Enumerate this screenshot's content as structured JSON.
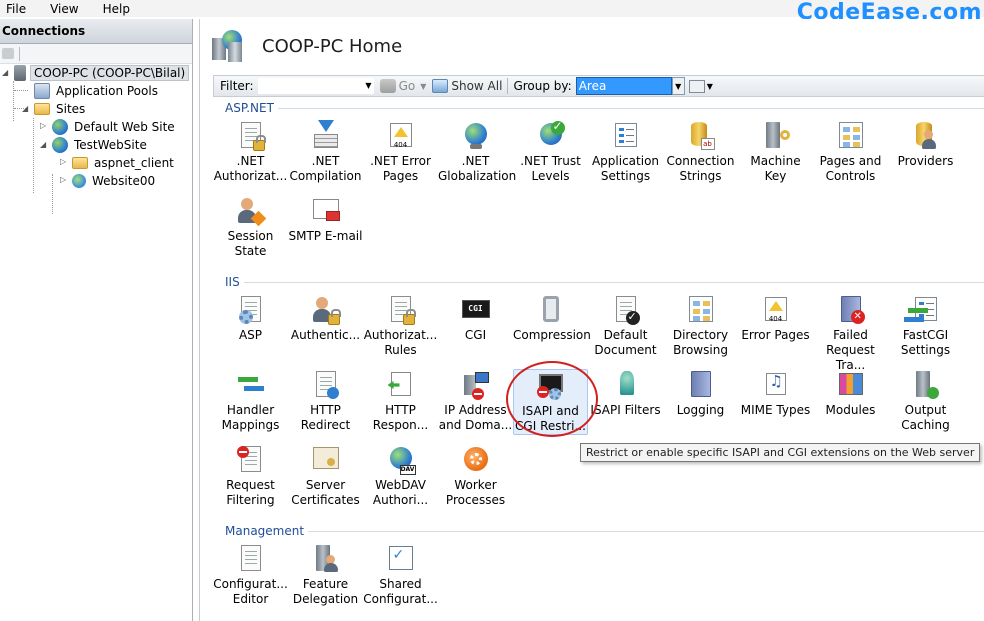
{
  "menu": [
    "File",
    "View",
    "Help"
  ],
  "watermark": "CodeEase.com",
  "connections": {
    "title": "Connections",
    "tree": {
      "server": "COOP-PC (COOP-PC\\Bilal)",
      "app_pools": "Application Pools",
      "sites": "Sites",
      "default_site": "Default Web Site",
      "test_site": "TestWebSite",
      "aspnet_client": "aspnet_client",
      "website00": "Website00"
    }
  },
  "main": {
    "title": "COOP-PC Home",
    "filter": {
      "label": "Filter:",
      "value": "",
      "go": "Go",
      "show_all": "Show All",
      "group_by_label": "Group by:",
      "group_by_value": "Area"
    },
    "sections": {
      "aspnet": {
        "title": "ASP.NET",
        "items": [
          {
            "label": ".NET\nAuthorizat...",
            "icon": "net-authorization-icon"
          },
          {
            "label": ".NET\nCompilation",
            "icon": "net-compilation-icon"
          },
          {
            "label": ".NET Error\nPages",
            "icon": "net-error-pages-icon"
          },
          {
            "label": ".NET\nGlobalization",
            "icon": "net-globalization-icon"
          },
          {
            "label": ".NET Trust\nLevels",
            "icon": "net-trust-levels-icon"
          },
          {
            "label": "Application\nSettings",
            "icon": "application-settings-icon"
          },
          {
            "label": "Connection\nStrings",
            "icon": "connection-strings-icon"
          },
          {
            "label": "Machine Key",
            "icon": "machine-key-icon"
          },
          {
            "label": "Pages and\nControls",
            "icon": "pages-and-controls-icon"
          },
          {
            "label": "Providers",
            "icon": "providers-icon"
          },
          {
            "label": "Session State",
            "icon": "session-state-icon"
          },
          {
            "label": "SMTP E-mail",
            "icon": "smtp-email-icon"
          }
        ]
      },
      "iis": {
        "title": "IIS",
        "items": [
          {
            "label": "ASP",
            "icon": "asp-icon"
          },
          {
            "label": "Authentic...",
            "icon": "authentication-icon"
          },
          {
            "label": "Authorizat...\nRules",
            "icon": "authorization-rules-icon"
          },
          {
            "label": "CGI",
            "icon": "cgi-icon"
          },
          {
            "label": "Compression",
            "icon": "compression-icon"
          },
          {
            "label": "Default\nDocument",
            "icon": "default-document-icon"
          },
          {
            "label": "Directory\nBrowsing",
            "icon": "directory-browsing-icon"
          },
          {
            "label": "Error Pages",
            "icon": "error-pages-icon"
          },
          {
            "label": "Failed\nRequest Tra...",
            "icon": "failed-request-tracing-icon"
          },
          {
            "label": "FastCGI\nSettings",
            "icon": "fastcgi-settings-icon"
          },
          {
            "label": "Handler\nMappings",
            "icon": "handler-mappings-icon"
          },
          {
            "label": "HTTP\nRedirect",
            "icon": "http-redirect-icon"
          },
          {
            "label": "HTTP\nRespon...",
            "icon": "http-response-headers-icon"
          },
          {
            "label": "IP Address\nand Doma...",
            "icon": "ip-address-domain-icon"
          },
          {
            "label": "ISAPI and\nCGI Restri...",
            "icon": "isapi-cgi-restrictions-icon"
          },
          {
            "label": "ISAPI Filters",
            "icon": "isapi-filters-icon"
          },
          {
            "label": "Logging",
            "icon": "logging-icon"
          },
          {
            "label": "MIME Types",
            "icon": "mime-types-icon"
          },
          {
            "label": "Modules",
            "icon": "modules-icon"
          },
          {
            "label": "Output\nCaching",
            "icon": "output-caching-icon"
          },
          {
            "label": "Request\nFiltering",
            "icon": "request-filtering-icon"
          },
          {
            "label": "Server\nCertificates",
            "icon": "server-certificates-icon"
          },
          {
            "label": "WebDAV\nAuthori...",
            "icon": "webdav-authoring-icon"
          },
          {
            "label": "Worker\nProcesses",
            "icon": "worker-processes-icon"
          }
        ]
      },
      "management": {
        "title": "Management",
        "items": [
          {
            "label": "Configurat...\nEditor",
            "icon": "configuration-editor-icon"
          },
          {
            "label": "Feature\nDelegation",
            "icon": "feature-delegation-icon"
          },
          {
            "label": "Shared\nConfigurat...",
            "icon": "shared-configuration-icon"
          }
        ]
      }
    },
    "tooltip": "Restrict or enable specific ISAPI and CGI extensions on the Web server"
  }
}
